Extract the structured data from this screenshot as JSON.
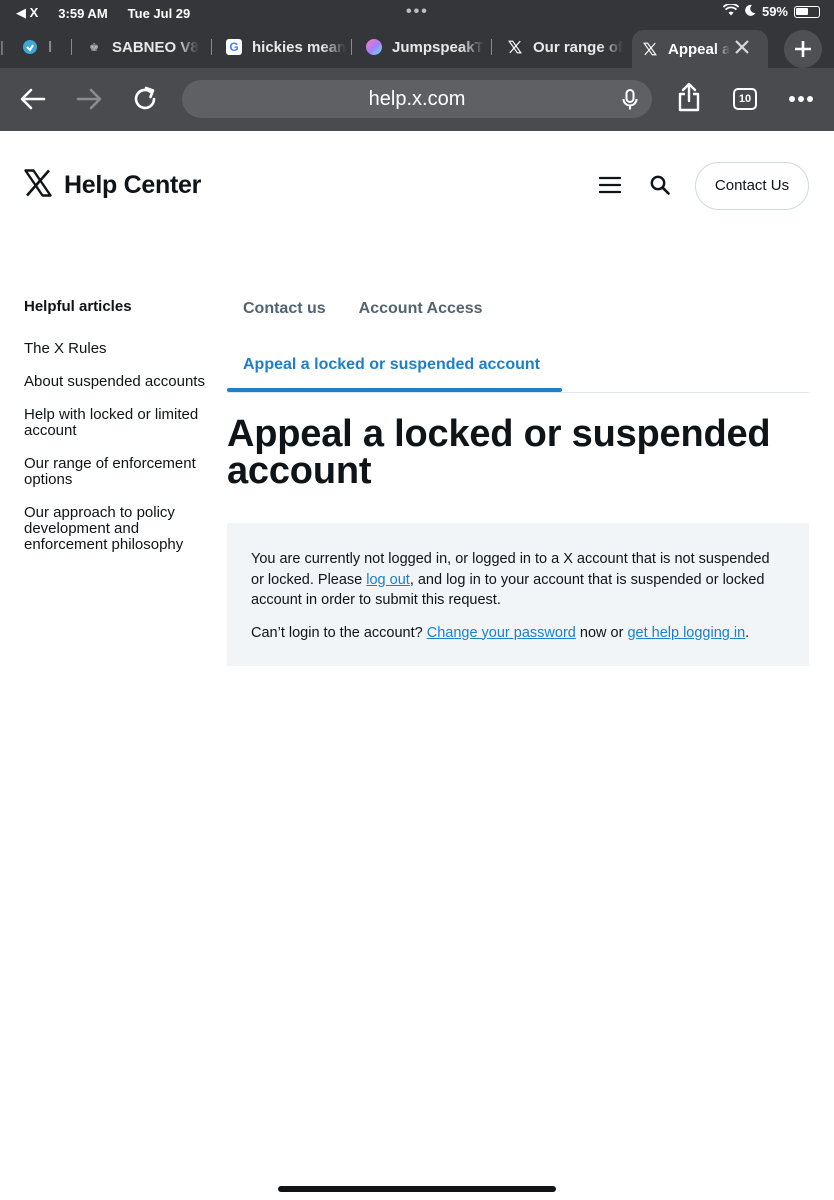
{
  "status_bar": {
    "back_app": "◀ X",
    "time": "3:59 AM",
    "date": "Tue Jul 29",
    "battery": "59%",
    "battery_level": 0.59
  },
  "tabs": [
    {
      "label": "l",
      "icon": "app-icon"
    },
    {
      "label": "SABNEO V8",
      "icon": "sabneo-icon"
    },
    {
      "label": "hickies mean",
      "icon": "google-icon"
    },
    {
      "label": "JumpspeakT",
      "icon": "jumpspeak-icon"
    },
    {
      "label": "Our range of",
      "icon": "x-logo-icon"
    },
    {
      "label": "Appeal a",
      "icon": "x-logo-icon",
      "active": true
    }
  ],
  "toolbar": {
    "url": "help.x.com",
    "tab_count": "10"
  },
  "header": {
    "title": "Help Center",
    "contact_button": "Contact Us"
  },
  "sidebar": {
    "title": "Helpful articles",
    "items": [
      "The X Rules",
      "About suspended accounts",
      "Help with locked or limited account",
      "Our range of enforcement options",
      "Our approach to policy development and enforcement philosophy"
    ]
  },
  "breadcrumbs": {
    "items": [
      "Contact us",
      "Account Access"
    ],
    "active": "Appeal a locked or suspended account"
  },
  "main": {
    "title": "Appeal a locked or suspended account",
    "notice": {
      "p1_part1": "You are currently not logged in, or logged in to a X account that is not suspended or locked. Please ",
      "p1_link": "log out",
      "p1_part2": ", and log in to your account that is suspended or locked account in order to submit this request.",
      "p2_part1": "Can’t login to the account? ",
      "p2_link1": "Change your password",
      "p2_mid": " now or ",
      "p2_link2": "get help logging in",
      "p2_end": "."
    }
  },
  "colors": {
    "chrome_dark": "#35363a",
    "chrome_toolbar": "#4a4b4f",
    "accent_blue": "#1d80c8",
    "notice_bg": "#f2f5f7",
    "text": "#0f1419",
    "muted": "#536471"
  }
}
